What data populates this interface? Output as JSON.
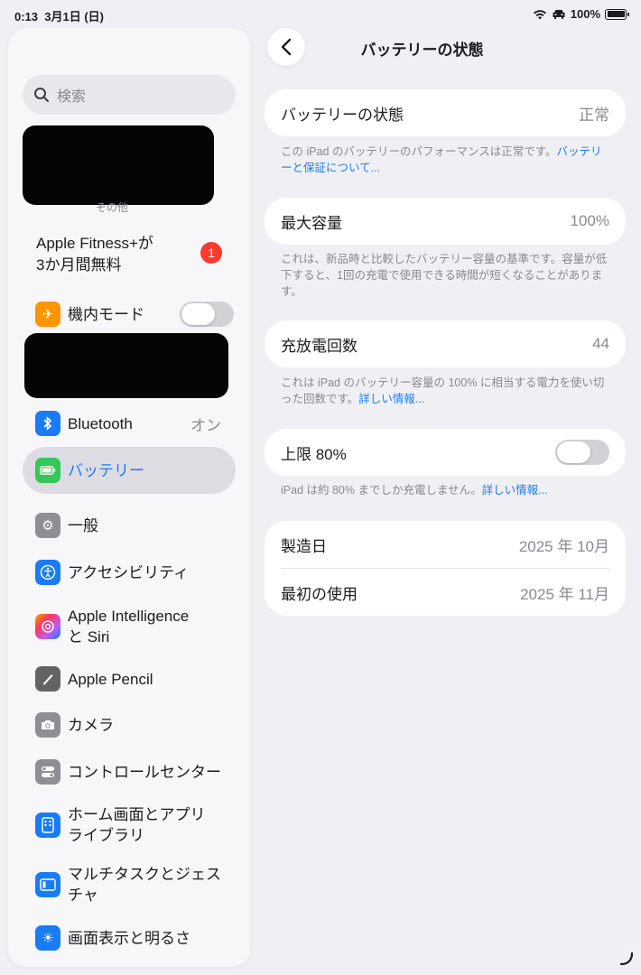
{
  "status_bar": {
    "time": "0:13",
    "date": "3月1日 (日)",
    "battery_percent": "100%"
  },
  "sidebar": {
    "search_placeholder": "検索",
    "other_label": "その他",
    "fitness_promo": "Apple Fitness+が\n3か月間無料",
    "fitness_badge": "1",
    "items": [
      {
        "label": "機内モード",
        "icon": "airplane-icon",
        "color": "#ff9500",
        "toggle": "off"
      },
      {
        "label": "Bluetooth",
        "icon": "bluetooth-icon",
        "color": "#1a7cf5",
        "value": "オン"
      },
      {
        "label": "バッテリー",
        "icon": "battery-icon",
        "color": "#34c759",
        "selected": true
      },
      {
        "label": "一般",
        "icon": "gear-icon",
        "color": "#8e8e93"
      },
      {
        "label": "アクセシビリティ",
        "icon": "accessibility-icon",
        "color": "#1a7cf5"
      },
      {
        "label": "Apple Intelligence\nと Siri",
        "icon": "apple-intelligence-icon",
        "color": "#ff6b9a"
      },
      {
        "label": "Apple Pencil",
        "icon": "pencil-icon",
        "color": "#636366"
      },
      {
        "label": "カメラ",
        "icon": "camera-icon",
        "color": "#8e8e93"
      },
      {
        "label": "コントロールセンター",
        "icon": "control-center-icon",
        "color": "#8e8e93"
      },
      {
        "label": "ホーム画面とアプリ\nライブラリ",
        "icon": "home-screen-icon",
        "color": "#1a7cf5"
      },
      {
        "label": "マルチタスクとジェス\nチャ",
        "icon": "multitasking-icon",
        "color": "#1a7cf5"
      },
      {
        "label": "画面表示と明るさ",
        "icon": "brightness-icon",
        "color": "#1a7cf5"
      }
    ]
  },
  "main": {
    "title": "バッテリーの状態",
    "health": {
      "label": "バッテリーの状態",
      "value": "正常"
    },
    "health_note": {
      "text": "この iPad のバッテリーのパフォーマンスは正常です。",
      "link": "バッテリーと保証について..."
    },
    "capacity": {
      "label": "最大容量",
      "value": "100%"
    },
    "capacity_note": "これは、新品時と比較したバッテリー容量の基準です。容量が低下すると、1回の充電で使用できる時間が短くなることがあります。",
    "cycles": {
      "label": "充放電回数",
      "value": "44"
    },
    "cycles_note": {
      "text": "これは iPad のバッテリー容量の 100% に相当する電力を使い切った回数です。",
      "link": "詳しい情報..."
    },
    "limit": {
      "label": "上限 80%",
      "state": "off"
    },
    "limit_note": {
      "text": "iPad は約 80% までしか充電しません。",
      "link": "詳しい情報..."
    },
    "manufacture": {
      "label": "製造日",
      "value": "2025 年 10月"
    },
    "first_use": {
      "label": "最初の使用",
      "value": "2025 年 11月"
    }
  }
}
